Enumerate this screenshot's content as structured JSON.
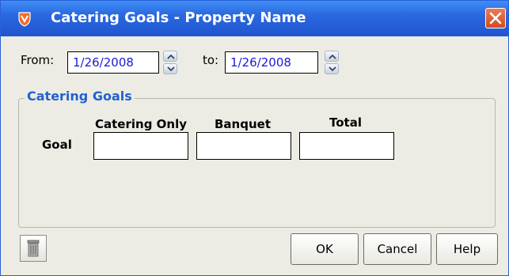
{
  "window": {
    "title": "Catering Goals - Property Name"
  },
  "date_range": {
    "from_label": "From:",
    "from_value": "1/26/2008",
    "to_label": "to:",
    "to_value": "1/26/2008"
  },
  "catering_goals": {
    "group_title": "Catering Goals",
    "row_label": "Goal",
    "columns": [
      "Catering Only",
      "Banquet",
      "Total"
    ],
    "values": [
      "",
      "",
      ""
    ]
  },
  "buttons": {
    "ok": "OK",
    "cancel": "Cancel",
    "help": "Help"
  },
  "colors": {
    "titlebar": "#2a68e0",
    "group_title": "#2460d0",
    "date_text": "#1a1ad8",
    "close_button": "#d24a22"
  },
  "icons": {
    "app": "app-logo-icon",
    "close": "close-icon",
    "spin_up": "chevron-up-icon",
    "spin_down": "chevron-down-icon",
    "delete": "trash-icon"
  }
}
